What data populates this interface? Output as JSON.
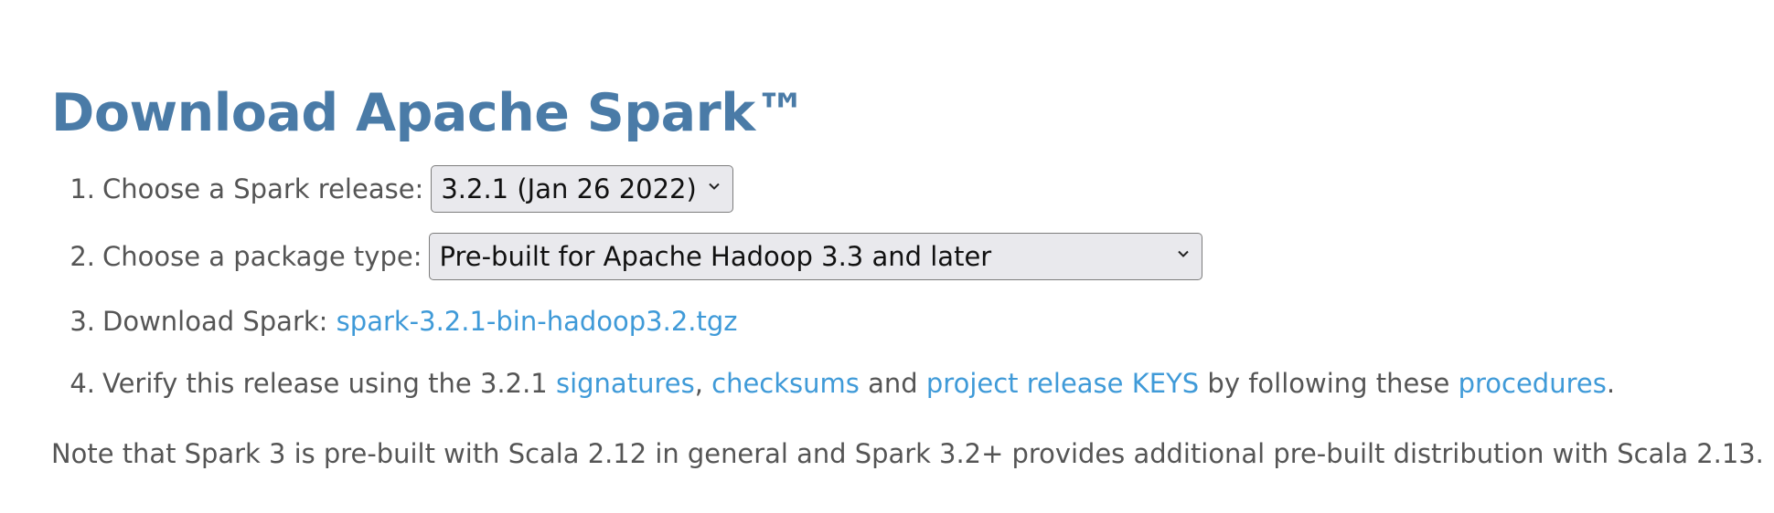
{
  "heading": "Download Apache Spark™",
  "steps": [
    {
      "num": "1.",
      "label": "Choose a Spark release:",
      "select_value": "3.2.1 (Jan 26 2022)"
    },
    {
      "num": "2.",
      "label": "Choose a package type:",
      "select_value": "Pre-built for Apache Hadoop 3.3 and later"
    },
    {
      "num": "3.",
      "label": "Download Spark:",
      "link": "spark-3.2.1-bin-hadoop3.2.tgz"
    },
    {
      "num": "4.",
      "text_1": "Verify this release using the 3.2.1",
      "link_signatures": "signatures",
      "sep_comma": ",",
      "link_checksums": "checksums",
      "text_and": "and",
      "link_keys": "project release KEYS",
      "text_by": "by following these",
      "link_procedures": "procedures",
      "end_period": "."
    }
  ],
  "note": "Note that Spark 3 is pre-built with Scala 2.12 in general and Spark 3.2+ provides additional pre-built distribution with Scala 2.13.",
  "colors": {
    "heading": "#4a7ba7",
    "link": "#3f9ad8",
    "text": "#555555",
    "select_bg": "#e9e9ed"
  },
  "icons": {
    "select_arrow": "chevron-down-icon"
  }
}
